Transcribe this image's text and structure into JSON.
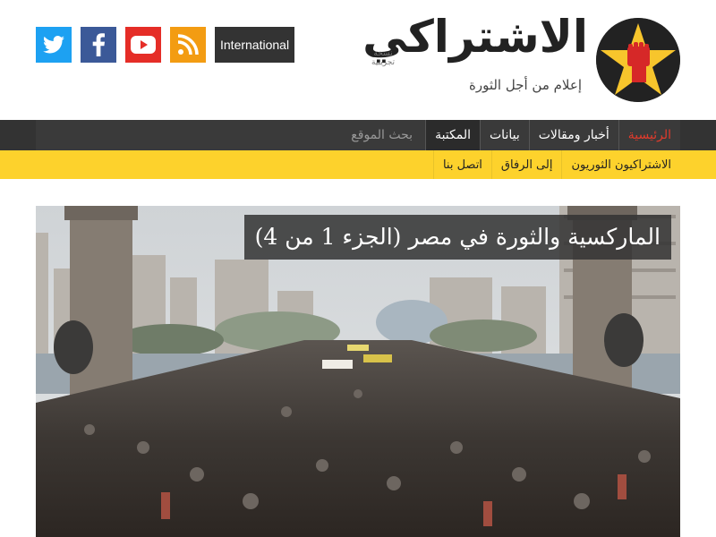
{
  "header": {
    "site_title": "الاشتراكي",
    "trial_note": "نسخة تجريبية",
    "tagline": "إعلام من أجل الثورة",
    "international_label": "International",
    "social": [
      {
        "name": "twitter",
        "icon": "twitter-icon",
        "color": "#1da1f2"
      },
      {
        "name": "facebook",
        "icon": "facebook-icon",
        "color": "#3b5998"
      },
      {
        "name": "youtube",
        "icon": "youtube-icon",
        "color": "#e52d27"
      },
      {
        "name": "rss",
        "icon": "rss-icon",
        "color": "#f39c12"
      }
    ]
  },
  "nav_primary": {
    "items": [
      {
        "label": "الرئيسية",
        "active": true
      },
      {
        "label": "أخبار ومقالات"
      },
      {
        "label": "بيانات"
      },
      {
        "label": "المكتبة"
      }
    ],
    "search_placeholder": "بحث الموقع"
  },
  "nav_secondary": {
    "items": [
      {
        "label": "الاشتراكيون الثوريون"
      },
      {
        "label": "إلى الرفاق"
      },
      {
        "label": "اتصل بنا"
      }
    ]
  },
  "hero": {
    "title": "الماركسية والثورة في مصر (الجزء 1 من 4)"
  },
  "colors": {
    "accent_red": "#e03b2c",
    "nav_dark": "#333333",
    "nav_yellow": "#fdd22c",
    "logo_star": "#f7c52c"
  }
}
